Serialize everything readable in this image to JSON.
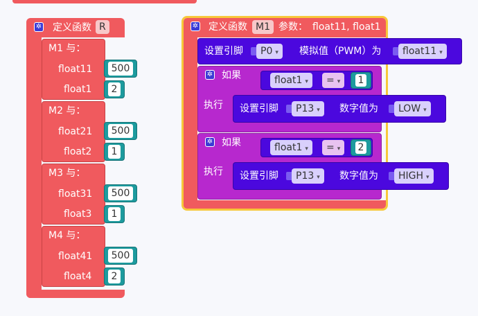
{
  "colors": {
    "procedure": "#f05a5e",
    "pin_block": "#4b08de",
    "if_block": "#b728ce",
    "number_block": "#1d9b9e",
    "selected_outline": "#f7c83a",
    "background": "#f7f8fc"
  },
  "left_proc": {
    "header": "定义函数",
    "name": "R",
    "groups": [
      {
        "label": "M1 与：",
        "params": [
          {
            "name": "float11",
            "value": "500"
          },
          {
            "name": "float1",
            "value": "2"
          }
        ]
      },
      {
        "label": "M2 与：",
        "params": [
          {
            "name": "float21",
            "value": "500"
          },
          {
            "name": "float2",
            "value": "1"
          }
        ]
      },
      {
        "label": "M3 与：",
        "params": [
          {
            "name": "float31",
            "value": "500"
          },
          {
            "name": "float3",
            "value": "1"
          }
        ]
      },
      {
        "label": "M4 与：",
        "params": [
          {
            "name": "float41",
            "value": "500"
          },
          {
            "name": "float4",
            "value": "2"
          }
        ]
      }
    ]
  },
  "right_proc": {
    "header": "定义函数",
    "name": "M1",
    "params_label": "参数：",
    "params_text": "float11, float1",
    "analog": {
      "set_label": "设置引脚",
      "pin": "P0",
      "mid_label": "模拟值（PWM）为",
      "var": "float11"
    },
    "ifs": [
      {
        "if_label": "如果",
        "var": "float1",
        "op": "=",
        "value": "1",
        "do_label": "执行",
        "set_label": "设置引脚",
        "pin": "P13",
        "mid_label": "数字值为",
        "level": "LOW"
      },
      {
        "if_label": "如果",
        "var": "float1",
        "op": "=",
        "value": "2",
        "do_label": "执行",
        "set_label": "设置引脚",
        "pin": "P13",
        "mid_label": "数字值为",
        "level": "HIGH"
      }
    ]
  }
}
